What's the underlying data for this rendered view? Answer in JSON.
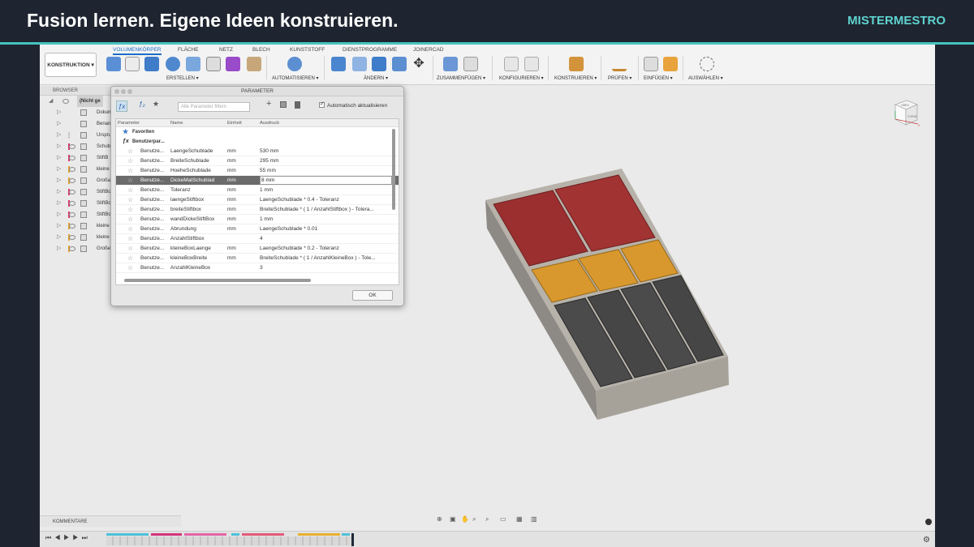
{
  "banner": {
    "title": "Fusion lernen. Eigene Ideen konstruieren.",
    "brand": "MISTERMESTRO"
  },
  "toolbar": {
    "mode_label": "KONSTRUKTION ▾",
    "tabs": [
      "VOLUMENKÖRPER",
      "FLÄCHE",
      "NETZ",
      "BLECH",
      "KUNSTSTOFF",
      "DIENSTPROGRAMME",
      "JOINERCAD"
    ],
    "groups": [
      "ERSTELLEN ▾",
      "AUTOMATISIEREN ▾",
      "ÄNDERN ▾",
      "ZUSAMMENFÜGEN ▾",
      "KONFIGURIEREN ▾",
      "KONSTRUIEREN ▾",
      "PRÜFEN ▾",
      "EINFÜGEN ▾",
      "AUSWÄHLEN ▾"
    ]
  },
  "browser": {
    "header": "BROWSER",
    "root": "(Nicht ge",
    "items": [
      "Dokumente",
      "Benannte A",
      "Urspru",
      "Schub",
      "StiftB",
      "kleine",
      "Großa",
      "StiftBo",
      "StiftBo",
      "StiftBo",
      "kleine",
      "kleine",
      "Große"
    ],
    "bar_colors": [
      "#c9c9c9",
      "#c9c9c9",
      "#c9c9c9",
      "#d9366a",
      "#d9366a",
      "#e0a02b",
      "#e0a02b",
      "#d9366a",
      "#d9366a",
      "#d9366a",
      "#e0a02b",
      "#e0a02b",
      "#e0a02b"
    ]
  },
  "dialog": {
    "title": "PARAMETER",
    "filter_placeholder": "Alle Parameter filtern",
    "auto_update": "Automatisch aktualisieren",
    "columns": [
      "Parameter",
      "Name",
      "Einheit",
      "Ausdruck"
    ],
    "groups": [
      "Favoriten",
      "Benutzerpar..."
    ],
    "rows": [
      {
        "type": "Benutze...",
        "name": "LaengeSchublade",
        "unit": "mm",
        "expr": "530 mm"
      },
      {
        "type": "Benutze...",
        "name": "BreiteSchublade",
        "unit": "mm",
        "expr": "295 mm"
      },
      {
        "type": "Benutze...",
        "name": "HoeheSchublade",
        "unit": "mm",
        "expr": "55 mm"
      },
      {
        "type": "Benutze...",
        "name": "DickeMatSchublad",
        "unit": "mm",
        "expr": "8 mm"
      },
      {
        "type": "Benutze...",
        "name": "Toleranz",
        "unit": "mm",
        "expr": "1 mm"
      },
      {
        "type": "Benutze...",
        "name": "laengeStiftbox",
        "unit": "mm",
        "expr": "LaengeSchublade * 0.4 - Toleranz"
      },
      {
        "type": "Benutze...",
        "name": "breiteStiftbox",
        "unit": "mm",
        "expr": "BreiteSchublade * ( 1 / AnzahlStiftbox ) - Tolera..."
      },
      {
        "type": "Benutze...",
        "name": "wandDickeStiftBox",
        "unit": "mm",
        "expr": "1 mm"
      },
      {
        "type": "Benutze...",
        "name": "Abrundung",
        "unit": "mm",
        "expr": "LaengeSchublade * 0.01"
      },
      {
        "type": "Benutze...",
        "name": "AnzahlStiftbox",
        "unit": "",
        "expr": "4"
      },
      {
        "type": "Benutze...",
        "name": "kleineBoxLaenge",
        "unit": "mm",
        "expr": "LaengeSchublade * 0.2 - Toleranz"
      },
      {
        "type": "Benutze...",
        "name": "kleineBoxBreite",
        "unit": "mm",
        "expr": "BreiteSchublade * ( 1 / AnzahlKleineBox ) - Tole..."
      },
      {
        "type": "Benutze...",
        "name": "AnzahlKleineBox",
        "unit": "",
        "expr": "3"
      }
    ],
    "selected_row": 3,
    "ok": "OK"
  },
  "viewcube": {
    "top": "OBEN",
    "front": "VORNE",
    "axis_x": "X"
  },
  "footer": {
    "comments": "KOMMENTARE"
  },
  "colors": {
    "accent": "#47c3c0",
    "brand": "#5fd3d0",
    "red": "#b03a3a",
    "orange": "#d99a2b",
    "dark": "#4a4a4a",
    "gray": "#a8a49c"
  }
}
